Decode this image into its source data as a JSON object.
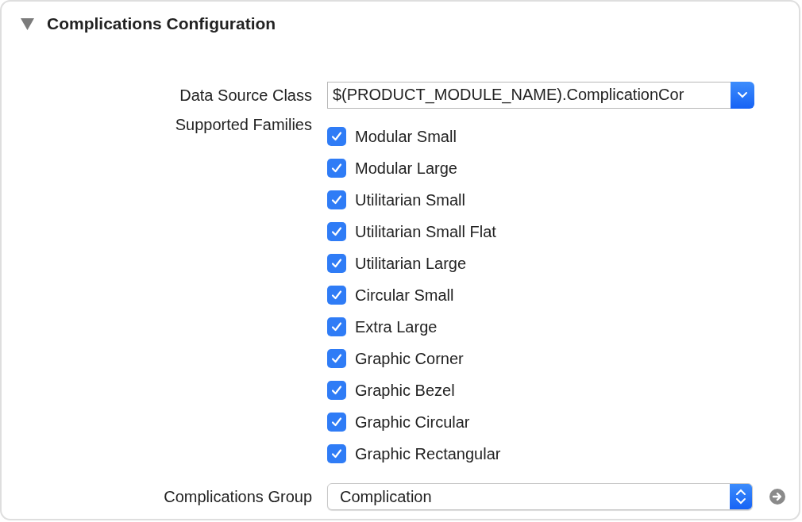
{
  "section": {
    "title": "Complications Configuration",
    "expanded": true
  },
  "data_source_class": {
    "label": "Data Source Class",
    "value": "$(PRODUCT_MODULE_NAME).ComplicationCor"
  },
  "supported_families": {
    "label": "Supported Families",
    "items": [
      {
        "label": "Modular Small",
        "checked": true
      },
      {
        "label": "Modular Large",
        "checked": true
      },
      {
        "label": "Utilitarian Small",
        "checked": true
      },
      {
        "label": "Utilitarian Small Flat",
        "checked": true
      },
      {
        "label": "Utilitarian Large",
        "checked": true
      },
      {
        "label": "Circular Small",
        "checked": true
      },
      {
        "label": "Extra Large",
        "checked": true
      },
      {
        "label": "Graphic Corner",
        "checked": true
      },
      {
        "label": "Graphic Bezel",
        "checked": true
      },
      {
        "label": "Graphic Circular",
        "checked": true
      },
      {
        "label": "Graphic Rectangular",
        "checked": true
      }
    ]
  },
  "complications_group": {
    "label": "Complications Group",
    "value": "Complication"
  }
}
